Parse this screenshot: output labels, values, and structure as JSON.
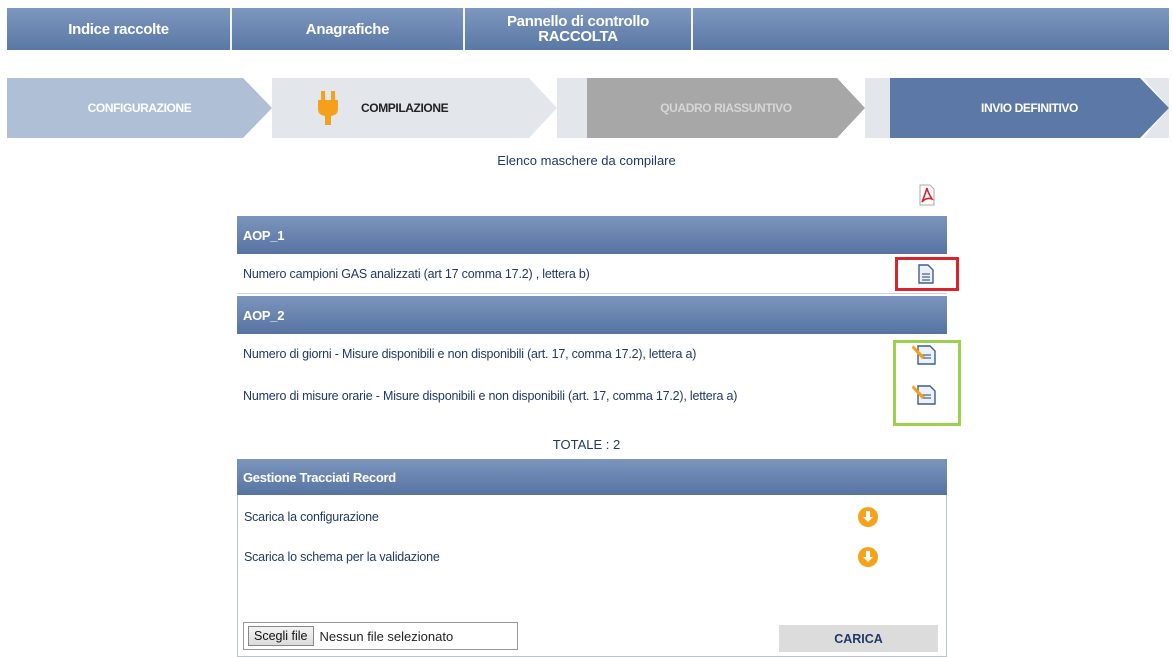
{
  "topnav": {
    "indice": "Indice raccolte",
    "anagrafiche": "Anagrafiche",
    "pannello_line1": "Pannello di controllo",
    "pannello_line2": "RACCOLTA"
  },
  "steps": {
    "configurazione": "CONFIGURAZIONE",
    "compilazione": "COMPILAZIONE",
    "quadro": "QUADRO RIASSUNTIVO",
    "invio": "INVIO DEFINITIVO"
  },
  "subtitle": "Elenco maschere da compilare",
  "sections": [
    {
      "title": "AOP_1",
      "rows": [
        {
          "label": "Numero campioni GAS analizzati (art 17 comma 17.2) , lettera b)",
          "icon": "document-icon"
        }
      ]
    },
    {
      "title": "AOP_2",
      "rows": [
        {
          "label": "Numero di giorni - Misure disponibili e non disponibili (art. 17, comma 17.2), lettera a)",
          "icon": "edit-document-icon"
        },
        {
          "label": "Numero di misure orarie - Misure disponibili e non disponibili (art. 17, comma 17.2), lettera a)",
          "icon": "edit-document-icon"
        }
      ]
    }
  ],
  "totale": "TOTALE : 2",
  "gestione": {
    "title": "Gestione Tracciati Record",
    "rows": [
      "Scarica la configurazione",
      "Scarica lo schema per la validazione"
    ],
    "file_button": "Scegli file",
    "file_status": "Nessun file selezionato",
    "carica": "CARICA"
  },
  "colors": {
    "nav": "#5a78a5",
    "highlight_red": "#d9242b",
    "highlight_green": "#9cd24a",
    "accent_orange": "#f6a21a"
  }
}
